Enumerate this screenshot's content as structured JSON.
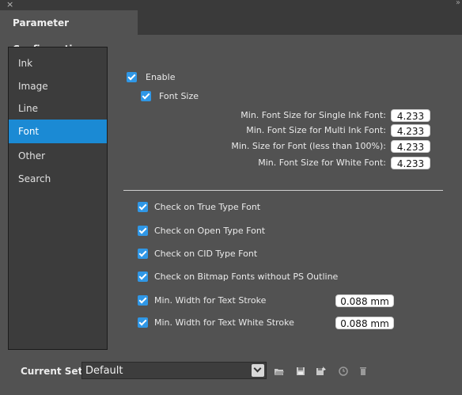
{
  "window": {
    "close_glyph": "×",
    "tab_title": "Parameter Configuration"
  },
  "sidebar": {
    "items": [
      {
        "label": "Ink",
        "active": false
      },
      {
        "label": "Image",
        "active": false
      },
      {
        "label": "Line",
        "active": false
      },
      {
        "label": "Font",
        "active": true
      },
      {
        "label": "Other",
        "active": false
      },
      {
        "label": "Search",
        "active": false
      }
    ]
  },
  "font_panel": {
    "enable_label": "Enable",
    "enable_checked": true,
    "font_size_label": "Font Size",
    "font_size_checked": true,
    "size_fields": [
      {
        "label": "Min. Font Size for Single Ink Font:",
        "value": "4.233"
      },
      {
        "label": "Min. Font Size for Multi Ink Font:",
        "value": "4.233"
      },
      {
        "label": "Min. Size for Font (less than 100%):",
        "value": "4.233"
      },
      {
        "label": "Min. Font Size for White Font:",
        "value": "4.233"
      }
    ],
    "checks": [
      {
        "label": "Check on True Type Font",
        "checked": true
      },
      {
        "label": "Check on Open Type Font",
        "checked": true
      },
      {
        "label": "Check on CID Type Font",
        "checked": true
      },
      {
        "label": "Check on Bitmap Fonts without PS Outline",
        "checked": true
      },
      {
        "label": "Min. Width for Text Stroke",
        "checked": true,
        "value": "0.088 mm"
      },
      {
        "label": "Min. Width for Text White Stroke",
        "checked": true,
        "value": "0.088 mm"
      }
    ]
  },
  "footer": {
    "current_set_label": "Current Set:",
    "current_set_value": "Default",
    "tools": [
      "open-icon",
      "save-icon",
      "save-as-icon",
      "history-icon",
      "delete-icon"
    ]
  },
  "colors": {
    "accent": "#1b8ad4",
    "checkbox": "#2f97e6",
    "panel_bg": "#525252",
    "sidebar_bg": "#3c3c3c"
  }
}
